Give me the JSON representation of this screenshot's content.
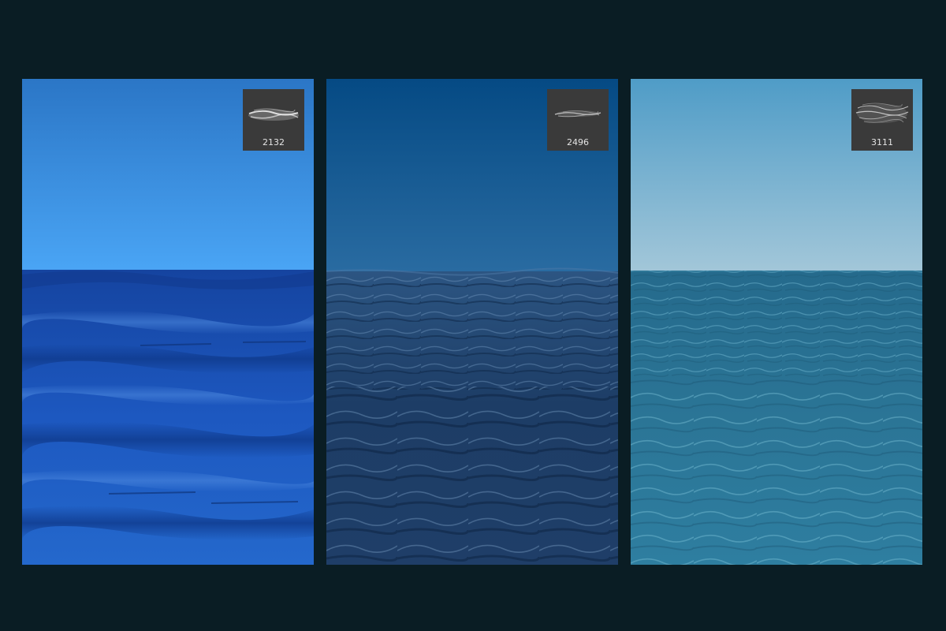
{
  "colors": {
    "page_background": "#0a1d24",
    "thumbnail_background": "#3a3a3a",
    "thumbnail_text": "#e4e4e4"
  },
  "panels": [
    {
      "brush_size": "2132",
      "style": "calm deep blue ocean",
      "sky_top": "#2b76c6",
      "sky_bottom": "#4aa5f5",
      "sea_top": "#1544a0",
      "sea_mid": "#1d58c0",
      "sea_bottom": "#2468cc",
      "highlight": "#4f8be0"
    },
    {
      "brush_size": "2496",
      "style": "choppy dark navy ocean",
      "sky_top": "#054a84",
      "sky_bottom": "#2a6ca2",
      "sea_top": "#2c5582",
      "sea_mid": "#1d3d66",
      "sea_bottom": "#1f3e68",
      "highlight": "#6e94bd"
    },
    {
      "brush_size": "3111",
      "style": "teal ocean with caustic ripples",
      "sky_top": "#4f9cc7",
      "sky_bottom": "#a3c7d9",
      "sea_top": "#256a8c",
      "sea_mid": "#2b7596",
      "sea_bottom": "#2e7ea0",
      "highlight": "#6fb6cf"
    }
  ]
}
